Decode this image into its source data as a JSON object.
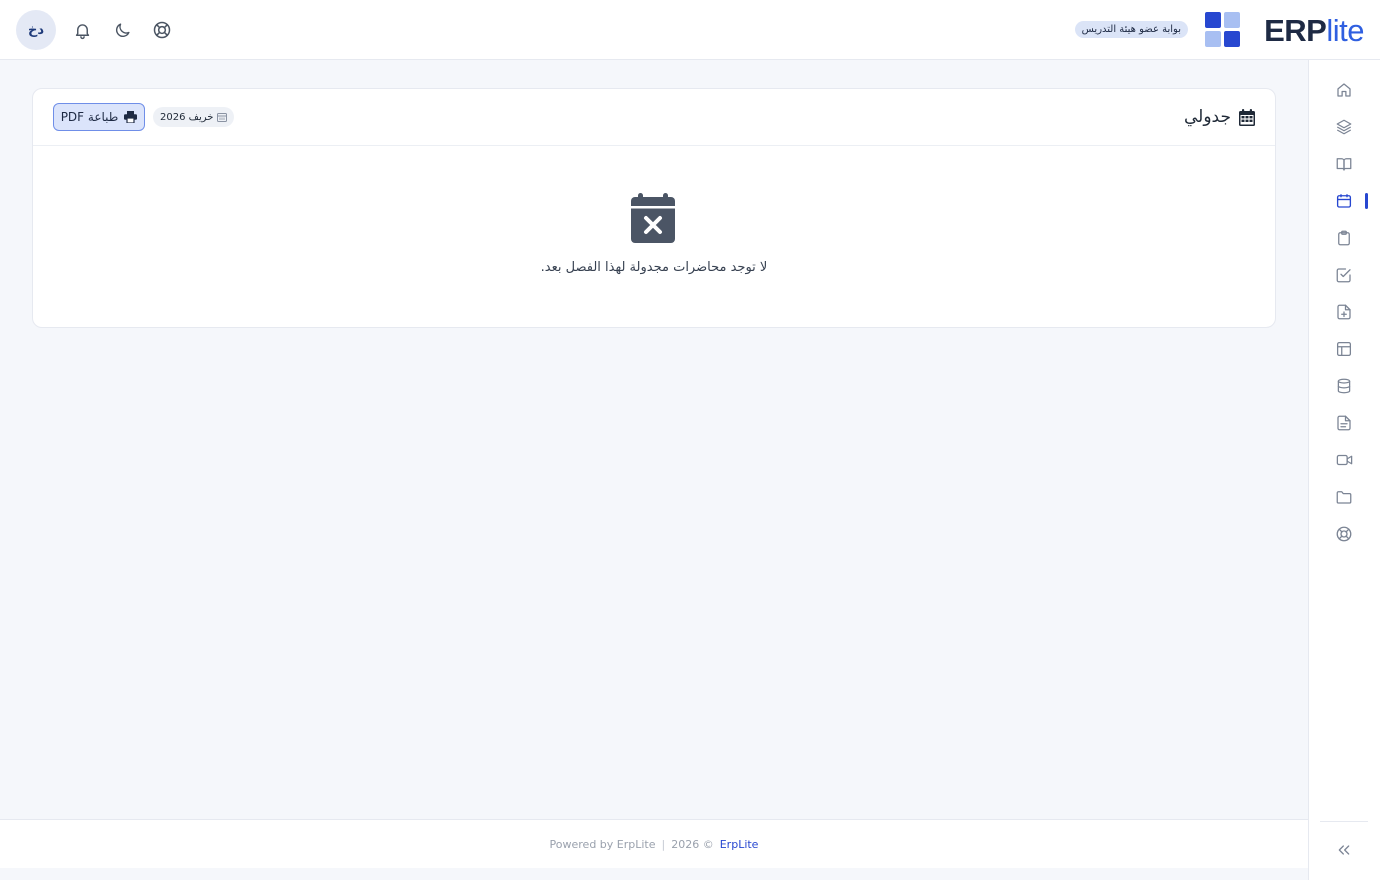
{
  "header": {
    "logo_erp": "ERP",
    "logo_lite": "lite",
    "portal_badge": "بوابة عضو هيئة التدريس",
    "avatar_initials": "دخ",
    "icons": [
      "support-icon",
      "moon-icon",
      "bell-icon"
    ]
  },
  "sidebar": {
    "items": [
      {
        "name": "home-icon",
        "active": false
      },
      {
        "name": "layers-icon",
        "active": false
      },
      {
        "name": "book-icon",
        "active": false
      },
      {
        "name": "calendar-icon",
        "active": true
      },
      {
        "name": "clipboard-icon",
        "active": false
      },
      {
        "name": "check-square-icon",
        "active": false
      },
      {
        "name": "file-plus-icon",
        "active": false
      },
      {
        "name": "layout-icon",
        "active": false
      },
      {
        "name": "database-icon",
        "active": false
      },
      {
        "name": "file-text-icon",
        "active": false
      },
      {
        "name": "video-icon",
        "active": false
      },
      {
        "name": "folder-icon",
        "active": false
      },
      {
        "name": "support-icon",
        "active": false
      }
    ],
    "collapse_icon": "chevrons-left-icon"
  },
  "main": {
    "title": "جدولي",
    "term_badge": "خريف 2026",
    "print_label": "طباعة PDF",
    "empty_message": "لا توجد محاضرات مجدولة لهذا الفصل بعد."
  },
  "footer": {
    "powered": "Powered by ErpLite",
    "separator": "|",
    "copyright": "2026 ©",
    "brand": "ErpLite"
  },
  "colors": {
    "accent": "#2747d0",
    "brand_dark": "#1e2a44",
    "background": "#f5f7fb"
  }
}
